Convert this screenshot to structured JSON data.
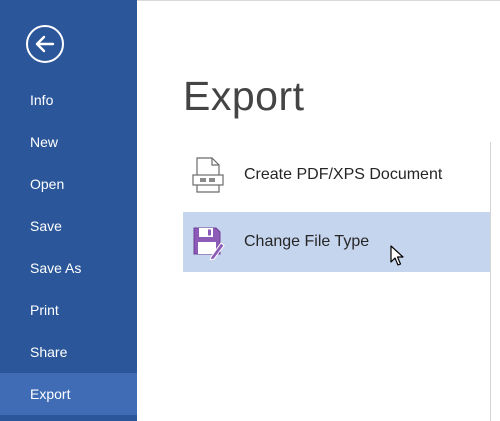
{
  "sidebar": {
    "back_icon": "back-arrow-icon",
    "background_color": "#2b579a",
    "active_color": "#3f6cb4",
    "items": [
      {
        "label": "Info"
      },
      {
        "label": "New"
      },
      {
        "label": "Open"
      },
      {
        "label": "Save"
      },
      {
        "label": "Save As"
      },
      {
        "label": "Print"
      },
      {
        "label": "Share"
      },
      {
        "label": "Export",
        "active": true
      }
    ]
  },
  "main": {
    "title": "Export",
    "options": [
      {
        "label": "Create PDF/XPS Document",
        "icon": "pdf-document-icon",
        "selected": false
      },
      {
        "label": "Change File Type",
        "icon": "change-file-type-icon",
        "selected": true
      }
    ]
  }
}
